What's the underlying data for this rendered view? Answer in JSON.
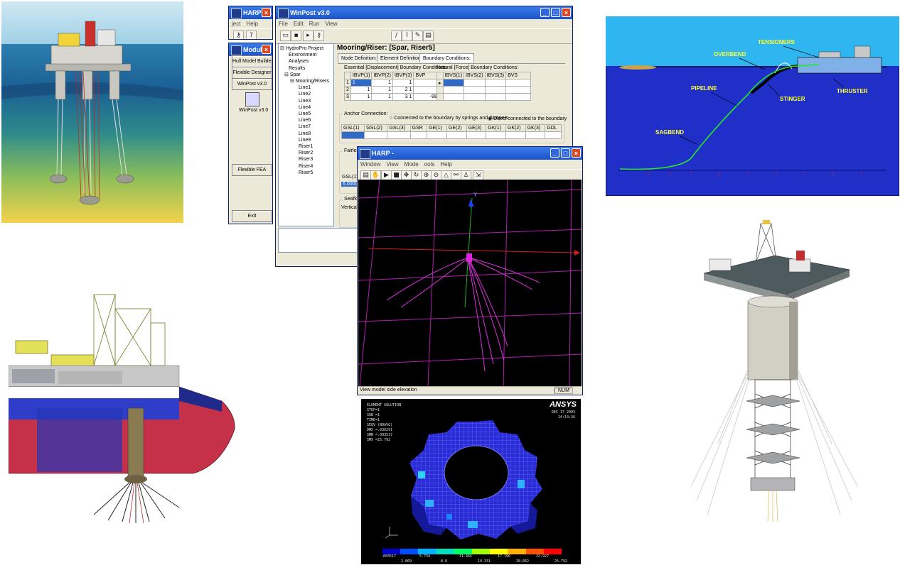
{
  "harp_main": {
    "title": "HARP v2.0",
    "menu": [
      "ject",
      "Help"
    ]
  },
  "modules": {
    "title": "Modules",
    "buttons": [
      "Hull Model Builder",
      "Flexible Designer",
      "WinPost v3.0"
    ],
    "winpost_icon_label": "WinPost v3.0",
    "fea_button": "Flexible FEA",
    "exit_button": "Exit"
  },
  "winpost": {
    "title": "WinPost v3.0",
    "menu": [
      "File",
      "Edit",
      "Run",
      "View"
    ],
    "heading": "Mooring/Riser: [Spar, Riser5]",
    "tabs": [
      "Node Definition:",
      "Element Definition:",
      "Boundary Conditions:"
    ],
    "tree": [
      "HydroPro Project",
      "Environment",
      "Analyses",
      "Results",
      "Spar",
      "Mooring/Risers",
      "Line1",
      "Line2",
      "Line3",
      "Line4",
      "Line5",
      "Line6",
      "Line7",
      "Line8",
      "Line9",
      "Riser1",
      "Riser2",
      "Riser3",
      "Riser4",
      "Riser5"
    ],
    "essential_label": "Essential [Displacement] Boundary Conditions:",
    "essential_headers": [
      "",
      "IBVP(1)",
      "IBVP(2)",
      "IBVP(3)",
      "BVP"
    ],
    "essential_rows": [
      [
        "1",
        "1",
        "1",
        "1",
        "3.81"
      ],
      [
        "2",
        "1",
        "1",
        "2",
        "1",
        "0"
      ],
      [
        "3",
        "1",
        "1",
        "3",
        "1",
        "-986.333"
      ]
    ],
    "natural_label": "Natural [Force] Boundary Conditions:",
    "natural_headers": [
      "",
      "IBVS(1)",
      "IBVS(2)",
      "IBVS(3)",
      "BVS"
    ],
    "anchor_label": "Anchor Connection:",
    "anchor_option_1": "Connected to the boundary by springs and dampers",
    "anchor_option_2": "Direct connected to the boundary",
    "anchor_headers": [
      "GSL(1)",
      "GSL(2)",
      "GSL(3)",
      "GSR",
      "GE(1)",
      "GE(2)",
      "GE(3)",
      "GK(1)",
      "GK(2)",
      "GK(3)",
      "GDL"
    ],
    "fairlead_label": "Fairlead C",
    "fairlead_header": "GSL(1)",
    "fairlead_value": "6.0000E",
    "seafloor_label": "Seafloor I",
    "vertical_label": "Vertical C"
  },
  "harp_view": {
    "title": "HARP -",
    "menu": [
      "Window",
      "View",
      "Mode",
      "ools",
      "Help"
    ],
    "axis_y": "Y",
    "status_text": "View model side elevation",
    "status_num": "NUM"
  },
  "pipeline": {
    "labels": {
      "tensioners": "TENSIONERS",
      "overbend": "OVERBEND",
      "pipeline": "PIPELINE",
      "stinger": "STINGER",
      "thruster": "THRUSTER",
      "sagbend": "SAGBEND"
    }
  },
  "ansys": {
    "logo": "ANSYS",
    "info_lines": [
      "ELEMENT SOLUTION",
      "STEP=1",
      "SUB =1",
      "TIME=1",
      "SEQV      (NOAVG)",
      "DMX =.030291",
      "SMN =.003517",
      "SMX =25.792"
    ],
    "date": "DEC 17 2003",
    "time": "14:13:26",
    "colorbar_top": [
      ".003517",
      "5.734",
      "11.465",
      "17.196",
      "22.927"
    ],
    "colorbar_bottom": [
      "2.869",
      "8.6",
      "14.331",
      "20.062",
      "25.792"
    ],
    "colors": [
      "#0000c8",
      "#0050ff",
      "#00b4ff",
      "#00e0c0",
      "#00ff60",
      "#a0ff00",
      "#ffff00",
      "#ffb000",
      "#ff5000",
      "#ff0000"
    ]
  }
}
